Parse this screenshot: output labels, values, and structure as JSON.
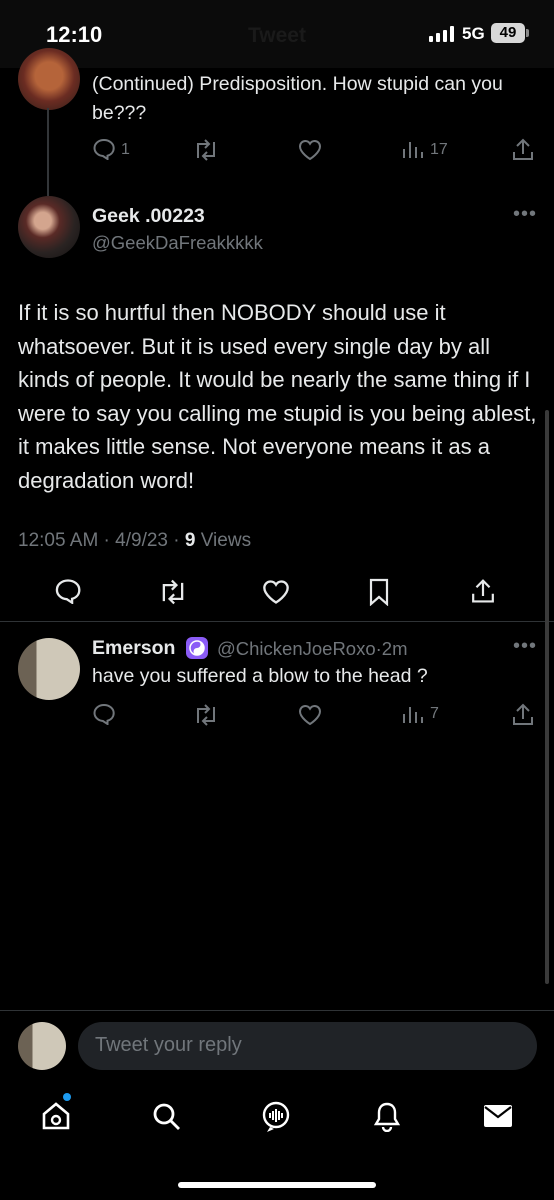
{
  "status_bar": {
    "time": "12:10",
    "header_title": "Tweet",
    "network": "5G",
    "battery": "49"
  },
  "parent_tweet": {
    "text": "(Continued) Predisposition. How stupid can you be???",
    "reply_count": "1",
    "views_count": "17"
  },
  "main_tweet": {
    "display_name": "Geek .00223",
    "handle": "@GeekDaFreakkkkk",
    "text": "If it is so hurtful then NOBODY should use it whatsoever. But it is used every single day by all kinds of people. It would be nearly the same thing if I were to say you calling me stupid is you being ablest, it makes little sense. Not everyone means it as a degradation word!",
    "timestamp": "12:05 AM · 4/9/23 · ",
    "views_number": "9",
    "views_label": " Views"
  },
  "reply_tweet": {
    "display_name": "Emerson",
    "badge_icon": "yin-yang-icon",
    "handle": "@ChickenJoeRoxo",
    "time": "·2m",
    "text": "have you suffered a blow to the head ?",
    "views_count": "7"
  },
  "composer": {
    "placeholder": "Tweet your reply"
  },
  "colors": {
    "background": "#000000",
    "text": "#e7e9ea",
    "muted": "#71767b",
    "accent": "#1d9bf0",
    "badge": "#8b5cf6"
  }
}
